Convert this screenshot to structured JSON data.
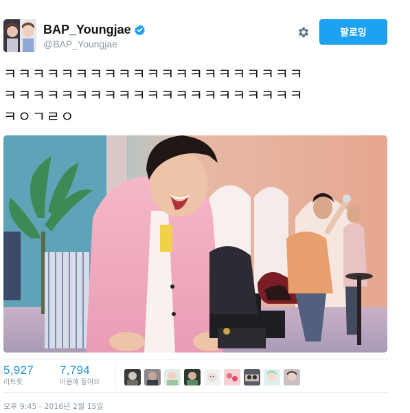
{
  "user": {
    "display_name": "BAP_Youngjae",
    "handle": "@BAP_Youngjae",
    "verified": true,
    "avatar_icon": "profile-photo"
  },
  "header": {
    "settings_icon": "gear-icon",
    "follow_label": "팔로잉"
  },
  "tweet": {
    "lines": [
      "ㅋㅋㅋㅋㅋㅋㅋㅋㅋㅋㅋㅋㅋㅋㅋㅋㅋㅋㅋㅋㅋ",
      "ㅋㅋㅋㅋㅋㅋㅋㅋㅋㅋㅋㅋㅋㅋㅋㅋㅋㅋㅋㅋㅋ",
      "ㅋㅇㄱㄹㅇ"
    ]
  },
  "stats": {
    "retweets": {
      "count": "5,927",
      "label": "리트윗"
    },
    "likes": {
      "count": "7,794",
      "label": "마음에 들어요"
    }
  },
  "likers": [
    {
      "icon": "avatar-1"
    },
    {
      "icon": "avatar-2"
    },
    {
      "icon": "avatar-3"
    },
    {
      "icon": "avatar-4"
    },
    {
      "icon": "avatar-5"
    },
    {
      "icon": "avatar-6"
    },
    {
      "icon": "avatar-7"
    },
    {
      "icon": "avatar-8"
    },
    {
      "icon": "avatar-9"
    }
  ],
  "timestamp": "오후 9:45 - 2016년 2월 15일",
  "colors": {
    "accent": "#1da1f2",
    "link": "#1b95e0",
    "muted": "#8899a6",
    "text": "#14171a"
  }
}
